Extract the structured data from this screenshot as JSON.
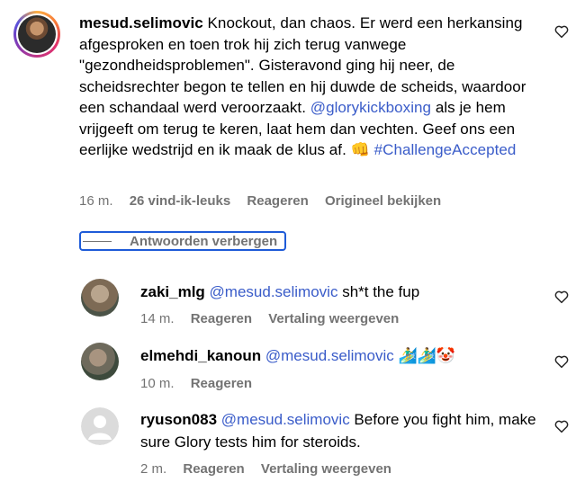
{
  "main_comment": {
    "username": "mesud.selimovic",
    "text_part1": "Knockout, dan chaos. Er werd een herkansing afgesproken en toen trok hij zich terug vanwege \"gezondheidsproblemen\". Gisteravond ging hij neer, de scheidsrechter begon te tellen en hij duwde de scheids, waardoor een schandaal werd veroorzaakt.",
    "mention": "@glorykickboxing",
    "text_part2": "als je hem vrijgeeft om terug te keren, laat hem dan vechten. Geef ons een eerlijke wedstrijd en ik maak de klus af. 👊",
    "hashtag": "#ChallengeAccepted",
    "time": "16 m.",
    "likes": "26 vind-ik-leuks",
    "reply": "Reageren",
    "see_original": "Origineel bekijken"
  },
  "toggle_replies": "Antwoorden verbergen",
  "replies": [
    {
      "username": "zaki_mlg",
      "mention": "@mesud.selimovic",
      "text": "sh*t the fup",
      "time": "14 m.",
      "reply": "Reageren",
      "translate": "Vertaling weergeven"
    },
    {
      "username": "elmehdi_kanoun",
      "mention": "@mesud.selimovic",
      "text": "🏄‍♂️🏄‍♂️🤡",
      "time": "10 m.",
      "reply": "Reageren"
    },
    {
      "username": "ryuson083",
      "mention": "@mesud.selimovic",
      "text": "Before you fight him, make sure Glory tests him for steroids.",
      "time": "2 m.",
      "reply": "Reageren",
      "translate": "Vertaling weergeven"
    }
  ],
  "icons": {
    "like": "heart-outline-icon",
    "default_avatar": "default-avatar-icon"
  },
  "colors": {
    "mention": "#3a5cc9",
    "meta": "#737373",
    "focus_outline": "#1e5bd8"
  }
}
